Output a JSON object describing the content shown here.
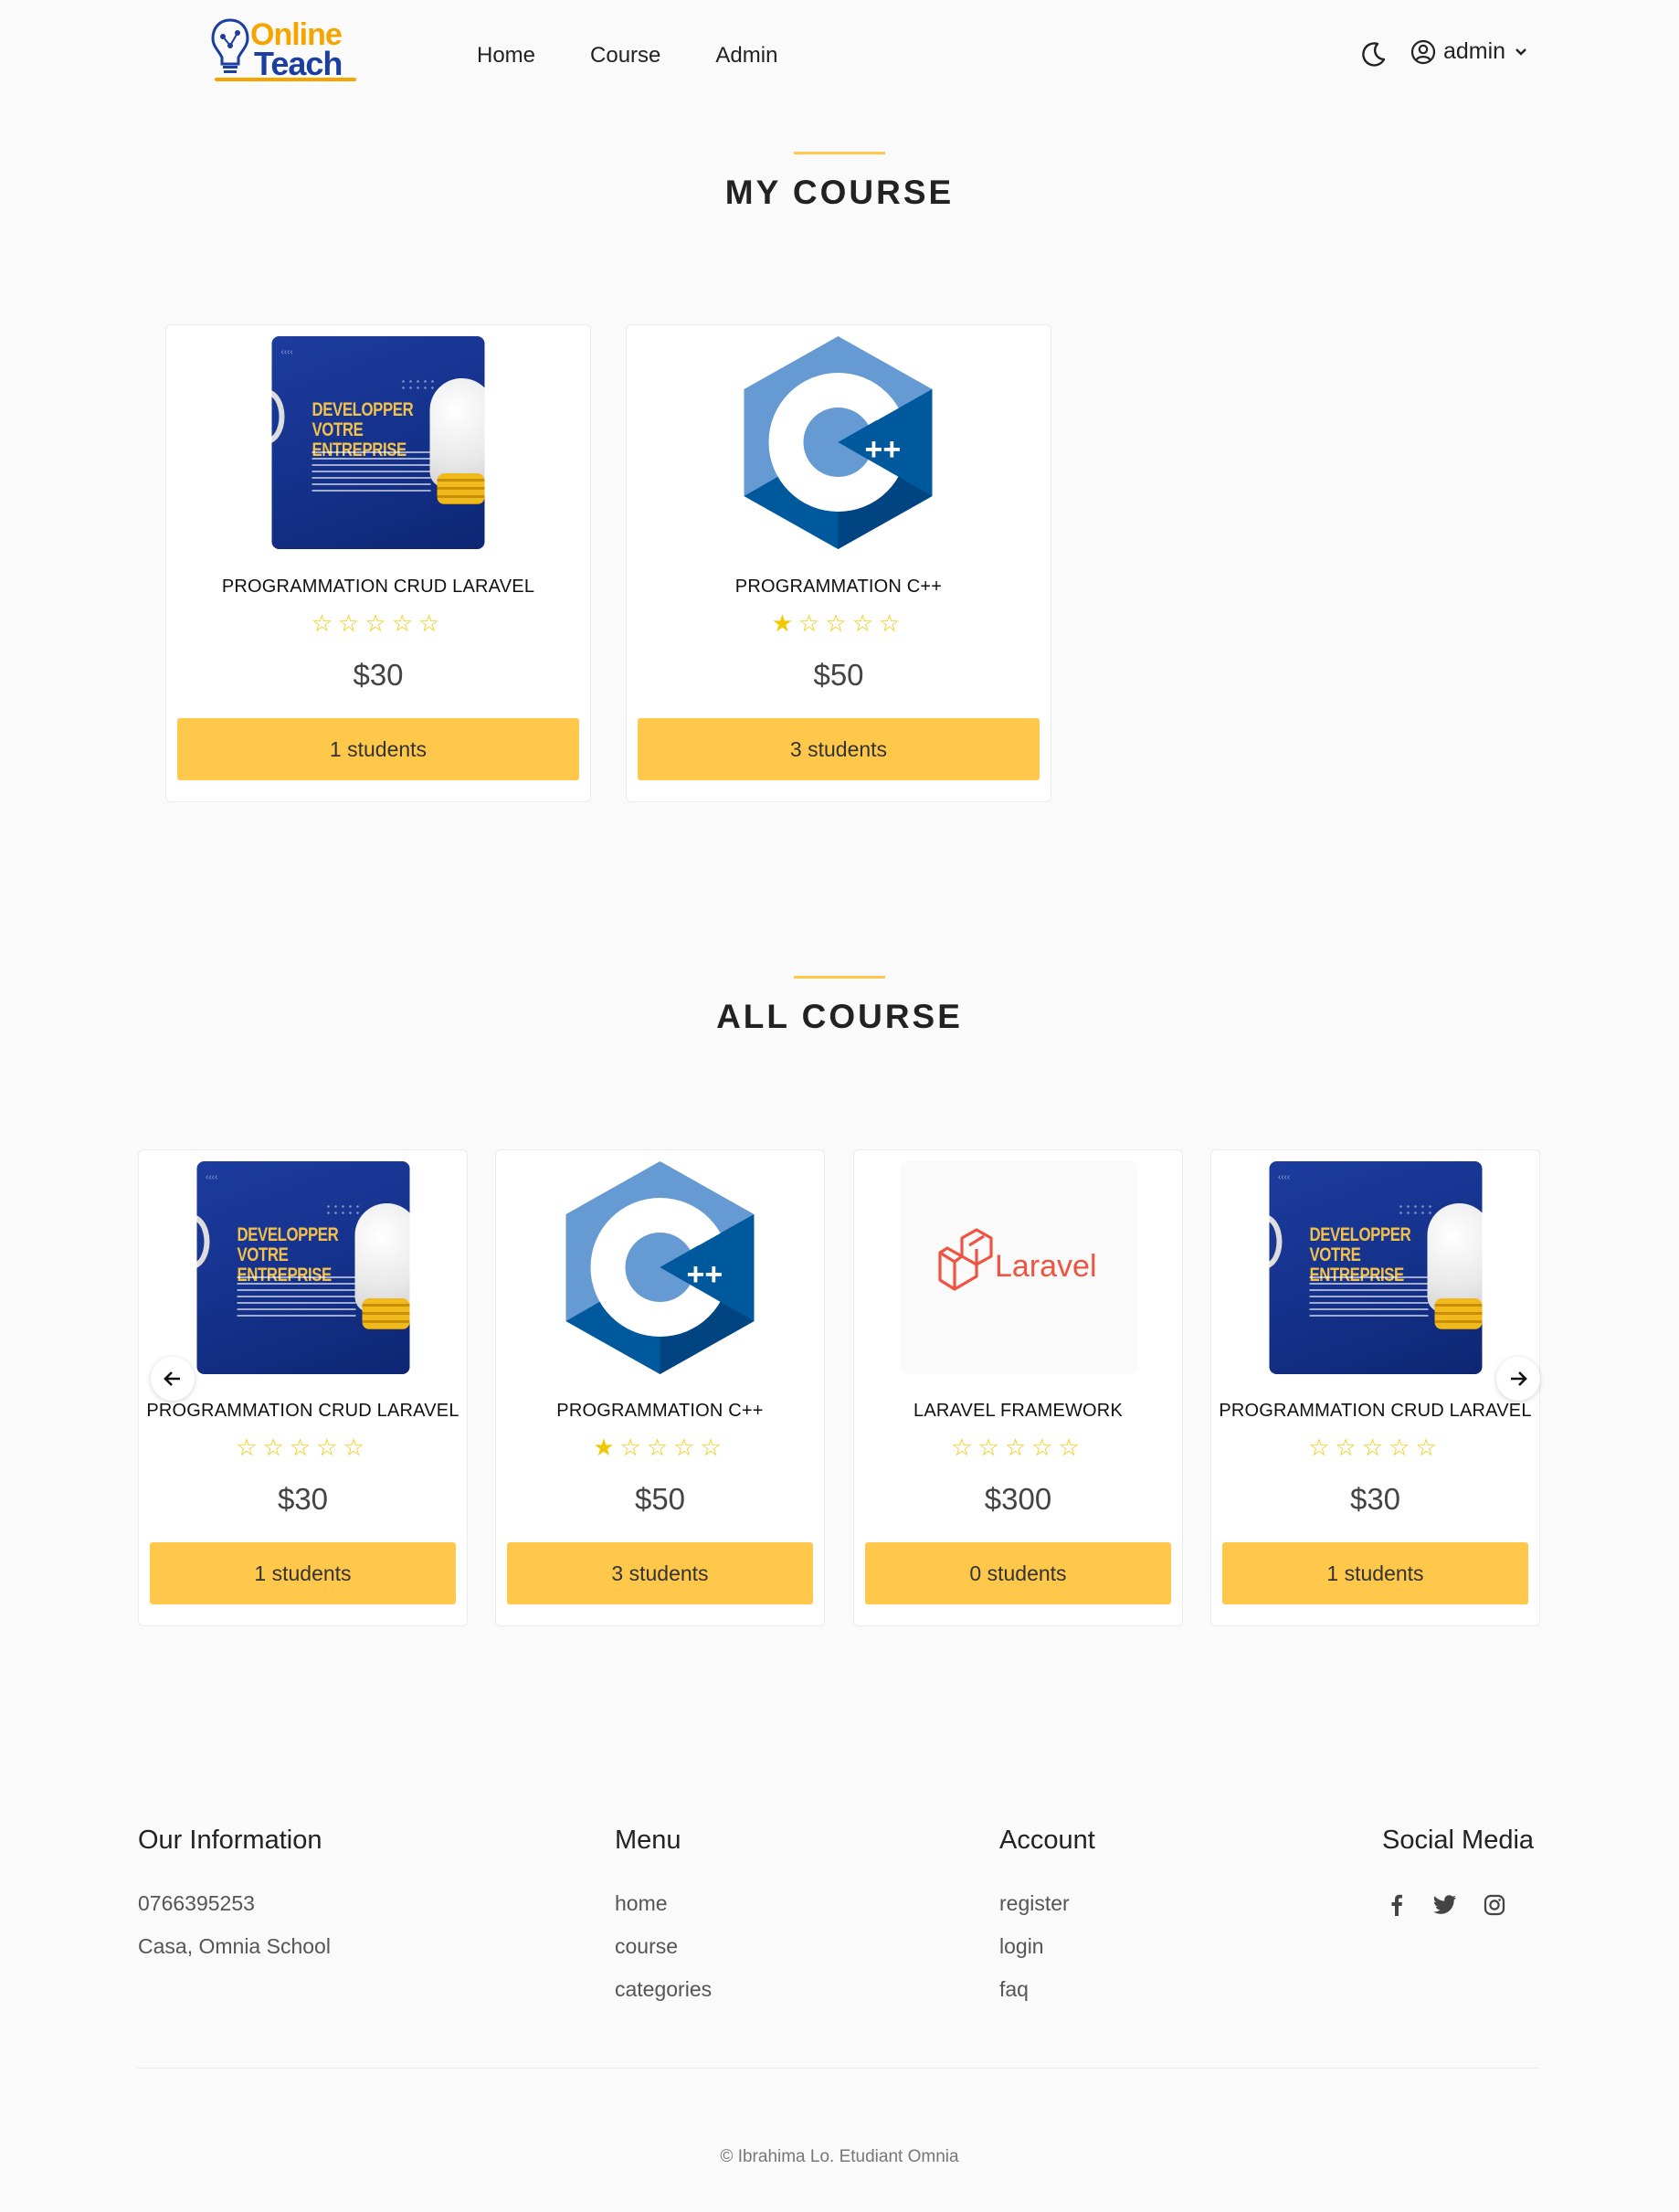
{
  "brand": {
    "line1": "Online",
    "line2": "Teach"
  },
  "nav": {
    "items": [
      "Home",
      "Course",
      "Admin"
    ],
    "user_label": "admin"
  },
  "my_course": {
    "title": "MY COURSE",
    "cards": [
      {
        "thumb": "developper-entreprise",
        "title": "PROGRAMMATION CRUD LARAVEL",
        "rating": 0,
        "stars": "☆☆☆☆☆",
        "price": "$30",
        "students": "1 students"
      },
      {
        "thumb": "cpp-logo",
        "title": "PROGRAMMATION C++",
        "rating": 1,
        "stars": "★☆☆☆☆",
        "price": "$50",
        "students": "3 students"
      }
    ]
  },
  "all_course": {
    "title": "ALL COURSE",
    "cards": [
      {
        "thumb": "developper-entreprise",
        "title": "PROGRAMMATION CRUD LARAVEL",
        "rating": 0,
        "stars": "☆☆☆☆☆",
        "price": "$30",
        "students": "1 students"
      },
      {
        "thumb": "cpp-logo",
        "title": "PROGRAMMATION C++",
        "rating": 1,
        "stars": "★☆☆☆☆",
        "price": "$50",
        "students": "3 students"
      },
      {
        "thumb": "laravel-logo",
        "title": "LARAVEL FRAMEWORK",
        "rating": 0,
        "stars": "☆☆☆☆☆",
        "price": "$300",
        "students": "0 students"
      },
      {
        "thumb": "developper-entreprise",
        "title": "PROGRAMMATION CRUD LARAVEL",
        "rating": 0,
        "stars": "☆☆☆☆☆",
        "price": "$30",
        "students": "1 students"
      }
    ]
  },
  "thumb_text": {
    "dev_line1": "DEVELOPPER",
    "dev_line2": "VOTRE ENTREPRISE",
    "laravel": "Laravel",
    "cpp_plus": "++"
  },
  "footer": {
    "info": {
      "title": "Our Information",
      "phone": "0766395253",
      "address": "Casa, Omnia School"
    },
    "menu": {
      "title": "Menu",
      "links": [
        "home",
        "course",
        "categories"
      ]
    },
    "account": {
      "title": "Account",
      "links": [
        "register",
        "login",
        "faq"
      ]
    },
    "social": {
      "title": "Social Media",
      "icons": [
        "facebook-icon",
        "twitter-icon",
        "instagram-icon"
      ]
    },
    "copyright": "© Ibrahima Lo. Etudiant Omnia"
  },
  "colors": {
    "accent": "#ffc84a",
    "brand_orange": "#f6a500",
    "brand_blue": "#1b3fa0",
    "star": "#f2c800"
  }
}
